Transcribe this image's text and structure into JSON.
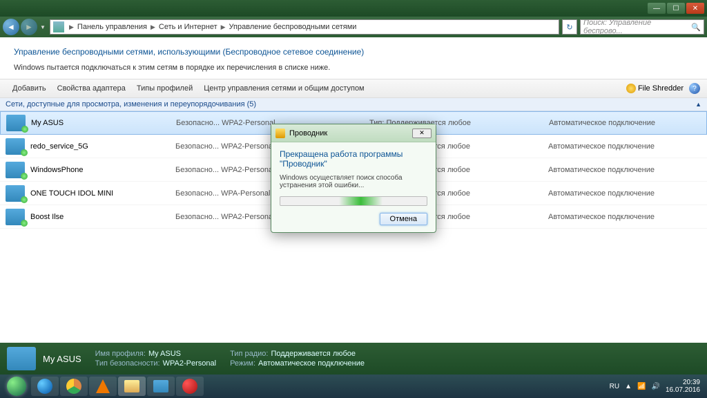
{
  "window": {
    "breadcrumb": [
      "Панель управления",
      "Сеть и Интернет",
      "Управление беспроводными сетями"
    ],
    "search_placeholder": "Поиск: Управление беспрово..."
  },
  "page": {
    "title": "Управление беспроводными сетями, использующими (Беспроводное сетевое соединение)",
    "description": "Windows пытается подключаться к этим сетям в порядке их перечисления в списке ниже."
  },
  "toolbar": {
    "add": "Добавить",
    "adapter_props": "Свойства адаптера",
    "profile_types": "Типы профилей",
    "network_center": "Центр управления сетями и общим доступом",
    "file_shredder": "File Shredder"
  },
  "group_header": "Сети, доступные для просмотра, изменения и переупорядочивания (5)",
  "columns": {
    "security_prefix": "Безопасно...",
    "type_prefix": "Тип:",
    "type_value": "Поддерживается любое",
    "auto": "Автоматическое подключение"
  },
  "networks": [
    {
      "name": "My ASUS",
      "security": "WPA2-Personal",
      "selected": true
    },
    {
      "name": "redo_service_5G",
      "security": "WPA2-Personal",
      "selected": false
    },
    {
      "name": "WindowsPhone",
      "security": "WPA2-Personal",
      "selected": false
    },
    {
      "name": "ONE TOUCH IDOL MINI",
      "security": "WPA-Personal",
      "selected": false
    },
    {
      "name": "Boost Ilse",
      "security": "WPA2-Personal",
      "selected": false
    }
  ],
  "details": {
    "name": "My ASUS",
    "profile_label": "Имя профиля:",
    "profile_value": "My ASUS",
    "sectype_label": "Тип безопасности:",
    "sectype_value": "WPA2-Personal",
    "radio_label": "Тип радио:",
    "radio_value": "Поддерживается любое",
    "mode_label": "Режим:",
    "mode_value": "Автоматическое подключение"
  },
  "dialog": {
    "title": "Проводник",
    "heading": "Прекращена работа программы \"Проводник\"",
    "body": "Windows осуществляет поиск способа устранения этой ошибки...",
    "cancel": "Отмена"
  },
  "tray": {
    "lang": "RU",
    "time": "20:39",
    "date": "16.07.2016"
  }
}
